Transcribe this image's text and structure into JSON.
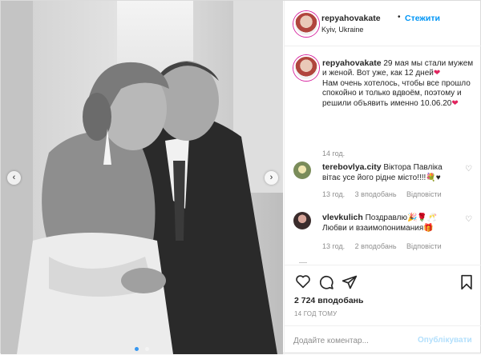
{
  "post": {
    "username": "repyahovakate",
    "separator": "•",
    "follow_label": "Стежити",
    "location": "Kyiv, Ukraine",
    "caption_line1": "29 мая мы стали мужем и женой. Вот уже, как 12 дней",
    "caption_line2": "Нам очень хотелось, чтобы все прошло спокойно и только вдвоём, поэтому и решили объявить именно 10.06.20",
    "heart_glyph": "❤",
    "caption_time": "14 год."
  },
  "comments": [
    {
      "username": "terebovlya.city",
      "text": "Віктора Павліка вітає усе його рідне місто!!!!💐♥",
      "time": "13 год.",
      "likes": "3 вподобань",
      "reply": "Відповісти"
    },
    {
      "username": "vlevkulich",
      "text": "Поздравлю🎉🌹🥂 Любви и взаимопонимания🎁",
      "time": "13 год.",
      "likes": "2 вподобань",
      "reply": "Відповісти"
    }
  ],
  "actions": {
    "likes_count": "2 724 вподобань",
    "posted_time": "14 ГОД ТОМУ"
  },
  "add_comment": {
    "placeholder": "Додайте коментар...",
    "publish_label": "Опублікувати"
  },
  "icons": {
    "like": "heart-outline-icon",
    "comment": "speech-bubble-icon",
    "share": "paper-plane-icon",
    "save": "bookmark-icon",
    "prev": "chevron-left-icon",
    "next": "chevron-right-icon"
  },
  "colors": {
    "link_blue": "#0095f6",
    "heart_red": "#e0245e",
    "meta_gray": "#8e8e8e",
    "dot_active": "#3797f0"
  },
  "carousel": {
    "slides": 2,
    "active_slide": 1
  }
}
